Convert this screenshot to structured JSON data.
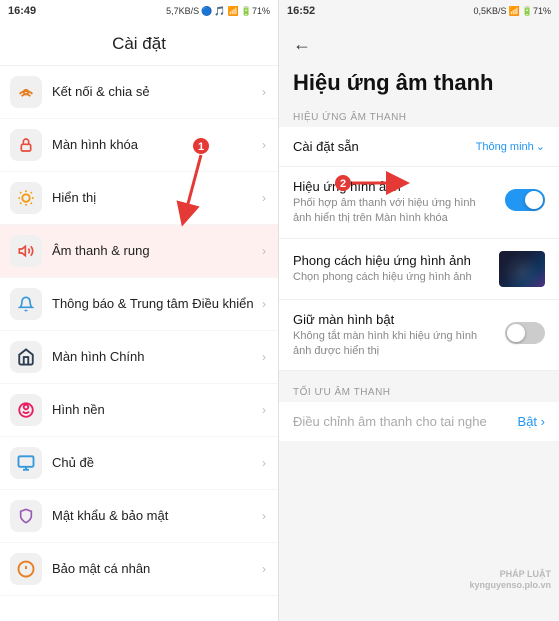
{
  "left": {
    "statusBar": {
      "time": "16:49",
      "networkSpeed": "5,7KB/S",
      "icons": "🔵🎵📶📶🔋71%"
    },
    "header": {
      "title": "Cài đặt"
    },
    "menuItems": [
      {
        "id": "wifi",
        "icon": "⊕",
        "iconClass": "icon-wifi",
        "label": "Kết nối & chia sẻ"
      },
      {
        "id": "lock",
        "icon": "🔒",
        "iconClass": "icon-lock",
        "label": "Màn hình khóa"
      },
      {
        "id": "display",
        "icon": "☀",
        "iconClass": "icon-display",
        "label": "Hiển thị"
      },
      {
        "id": "sound",
        "icon": "🔔",
        "iconClass": "icon-sound",
        "label": "Âm thanh & rung"
      },
      {
        "id": "notif",
        "icon": "📋",
        "iconClass": "icon-notif",
        "label": "Thông báo & Trung tâm Điều khiển"
      },
      {
        "id": "home",
        "icon": "🏠",
        "iconClass": "icon-home",
        "label": "Màn hình Chính"
      },
      {
        "id": "wallpaper",
        "icon": "🌸",
        "iconClass": "icon-wallpaper",
        "label": "Hình nền"
      },
      {
        "id": "theme",
        "icon": "🖥",
        "iconClass": "icon-theme",
        "label": "Chủ đề"
      },
      {
        "id": "password",
        "icon": "⚙",
        "iconClass": "icon-password",
        "label": "Mật khẩu & bảo mật"
      },
      {
        "id": "privacy",
        "icon": "🛡",
        "iconClass": "icon-privacy",
        "label": "Bảo mật cá nhân"
      }
    ]
  },
  "right": {
    "statusBar": {
      "time": "16:52",
      "networkSpeed": "0,5KB/S",
      "icons": "📶🔋71%"
    },
    "backLabel": "←",
    "title": "Hiệu ứng âm thanh",
    "sectionLabel": "HIỆU ỨNG ÂM THANH",
    "presetLabel": "Cài đặt sẵn",
    "presetValue": "Thông minh",
    "rows": [
      {
        "id": "image-effect",
        "title": "Hiệu ứng hình ảnh",
        "desc": "Phối hợp âm thanh với hiệu ứng hình ảnh hiển thị trên Màn hình khóa",
        "control": "toggle-on"
      },
      {
        "id": "effect-style",
        "title": "Phong cách hiệu ứng hình ảnh",
        "desc": "Chọn phong cách hiệu ứng hình ảnh",
        "control": "thumbnail"
      },
      {
        "id": "keep-screen",
        "title": "Giữ màn hình bật",
        "desc": "Không tắt màn hình khi hiệu ứng hình ảnh được hiển thị",
        "control": "toggle-off"
      }
    ],
    "optimizeSectionLabel": "TỐI ƯU ÂM THANH",
    "optimizeTitle": "Điều chỉnh âm thanh cho tai nghe",
    "optimizeValue": "Bật ›",
    "watermark": {
      "line1": "PHÁP LUẬT",
      "line2": "kynguyenso.plo.vn"
    }
  },
  "annotations": {
    "number1": "1",
    "number2": "2"
  }
}
